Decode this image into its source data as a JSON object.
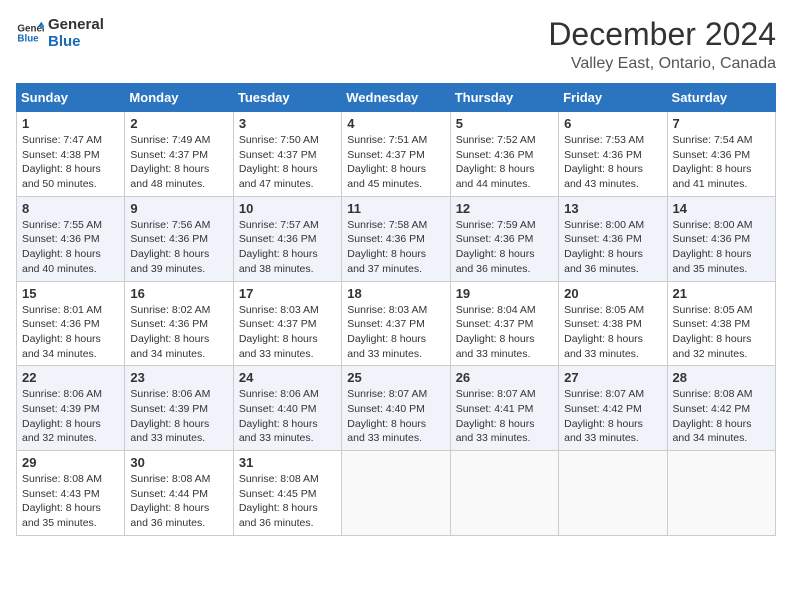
{
  "logo": {
    "line1": "General",
    "line2": "Blue"
  },
  "title": "December 2024",
  "subtitle": "Valley East, Ontario, Canada",
  "days_of_week": [
    "Sunday",
    "Monday",
    "Tuesday",
    "Wednesday",
    "Thursday",
    "Friday",
    "Saturday"
  ],
  "weeks": [
    [
      {
        "day": "1",
        "sunrise": "7:47 AM",
        "sunset": "4:38 PM",
        "daylight": "8 hours and 50 minutes."
      },
      {
        "day": "2",
        "sunrise": "7:49 AM",
        "sunset": "4:37 PM",
        "daylight": "8 hours and 48 minutes."
      },
      {
        "day": "3",
        "sunrise": "7:50 AM",
        "sunset": "4:37 PM",
        "daylight": "8 hours and 47 minutes."
      },
      {
        "day": "4",
        "sunrise": "7:51 AM",
        "sunset": "4:37 PM",
        "daylight": "8 hours and 45 minutes."
      },
      {
        "day": "5",
        "sunrise": "7:52 AM",
        "sunset": "4:36 PM",
        "daylight": "8 hours and 44 minutes."
      },
      {
        "day": "6",
        "sunrise": "7:53 AM",
        "sunset": "4:36 PM",
        "daylight": "8 hours and 43 minutes."
      },
      {
        "day": "7",
        "sunrise": "7:54 AM",
        "sunset": "4:36 PM",
        "daylight": "8 hours and 41 minutes."
      }
    ],
    [
      {
        "day": "8",
        "sunrise": "7:55 AM",
        "sunset": "4:36 PM",
        "daylight": "8 hours and 40 minutes."
      },
      {
        "day": "9",
        "sunrise": "7:56 AM",
        "sunset": "4:36 PM",
        "daylight": "8 hours and 39 minutes."
      },
      {
        "day": "10",
        "sunrise": "7:57 AM",
        "sunset": "4:36 PM",
        "daylight": "8 hours and 38 minutes."
      },
      {
        "day": "11",
        "sunrise": "7:58 AM",
        "sunset": "4:36 PM",
        "daylight": "8 hours and 37 minutes."
      },
      {
        "day": "12",
        "sunrise": "7:59 AM",
        "sunset": "4:36 PM",
        "daylight": "8 hours and 36 minutes."
      },
      {
        "day": "13",
        "sunrise": "8:00 AM",
        "sunset": "4:36 PM",
        "daylight": "8 hours and 36 minutes."
      },
      {
        "day": "14",
        "sunrise": "8:00 AM",
        "sunset": "4:36 PM",
        "daylight": "8 hours and 35 minutes."
      }
    ],
    [
      {
        "day": "15",
        "sunrise": "8:01 AM",
        "sunset": "4:36 PM",
        "daylight": "8 hours and 34 minutes."
      },
      {
        "day": "16",
        "sunrise": "8:02 AM",
        "sunset": "4:36 PM",
        "daylight": "8 hours and 34 minutes."
      },
      {
        "day": "17",
        "sunrise": "8:03 AM",
        "sunset": "4:37 PM",
        "daylight": "8 hours and 33 minutes."
      },
      {
        "day": "18",
        "sunrise": "8:03 AM",
        "sunset": "4:37 PM",
        "daylight": "8 hours and 33 minutes."
      },
      {
        "day": "19",
        "sunrise": "8:04 AM",
        "sunset": "4:37 PM",
        "daylight": "8 hours and 33 minutes."
      },
      {
        "day": "20",
        "sunrise": "8:05 AM",
        "sunset": "4:38 PM",
        "daylight": "8 hours and 33 minutes."
      },
      {
        "day": "21",
        "sunrise": "8:05 AM",
        "sunset": "4:38 PM",
        "daylight": "8 hours and 32 minutes."
      }
    ],
    [
      {
        "day": "22",
        "sunrise": "8:06 AM",
        "sunset": "4:39 PM",
        "daylight": "8 hours and 32 minutes."
      },
      {
        "day": "23",
        "sunrise": "8:06 AM",
        "sunset": "4:39 PM",
        "daylight": "8 hours and 33 minutes."
      },
      {
        "day": "24",
        "sunrise": "8:06 AM",
        "sunset": "4:40 PM",
        "daylight": "8 hours and 33 minutes."
      },
      {
        "day": "25",
        "sunrise": "8:07 AM",
        "sunset": "4:40 PM",
        "daylight": "8 hours and 33 minutes."
      },
      {
        "day": "26",
        "sunrise": "8:07 AM",
        "sunset": "4:41 PM",
        "daylight": "8 hours and 33 minutes."
      },
      {
        "day": "27",
        "sunrise": "8:07 AM",
        "sunset": "4:42 PM",
        "daylight": "8 hours and 33 minutes."
      },
      {
        "day": "28",
        "sunrise": "8:08 AM",
        "sunset": "4:42 PM",
        "daylight": "8 hours and 34 minutes."
      }
    ],
    [
      {
        "day": "29",
        "sunrise": "8:08 AM",
        "sunset": "4:43 PM",
        "daylight": "8 hours and 35 minutes."
      },
      {
        "day": "30",
        "sunrise": "8:08 AM",
        "sunset": "4:44 PM",
        "daylight": "8 hours and 36 minutes."
      },
      {
        "day": "31",
        "sunrise": "8:08 AM",
        "sunset": "4:45 PM",
        "daylight": "8 hours and 36 minutes."
      },
      null,
      null,
      null,
      null
    ]
  ]
}
